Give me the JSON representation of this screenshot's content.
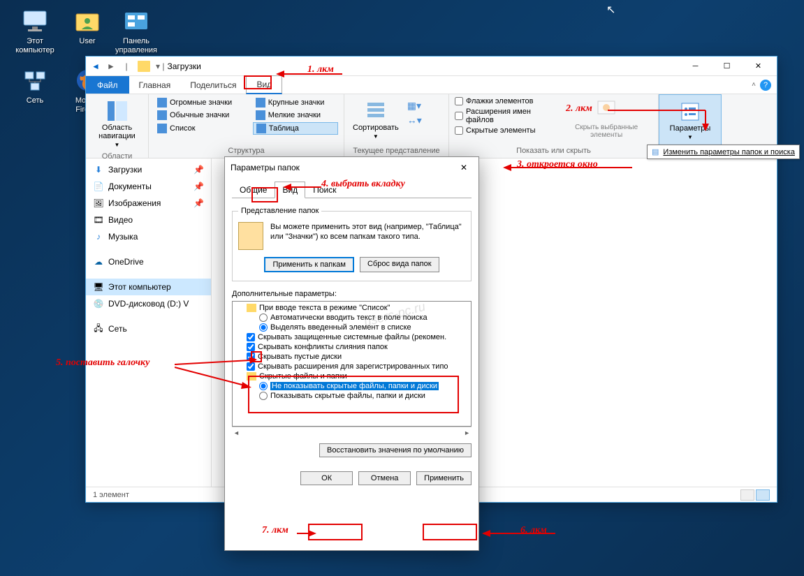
{
  "desktop": {
    "icons": [
      {
        "label": "Этот компьютер"
      },
      {
        "label": "User"
      },
      {
        "label": "Панель управления"
      },
      {
        "label": "Сеть"
      },
      {
        "label": "Mozilla Firefox"
      }
    ]
  },
  "explorer": {
    "title": "Загрузки",
    "menu_file": "Файл",
    "tabs": [
      "Главная",
      "Поделиться",
      "Вид"
    ],
    "ribbon": {
      "nav_panel": "Область навигации",
      "group_areas": "Области",
      "layouts": {
        "huge": "Огромные значки",
        "large": "Крупные значки",
        "normal": "Обычные значки",
        "small": "Мелкие значки",
        "list": "Список",
        "table": "Таблица"
      },
      "group_structure": "Структура",
      "sort": "Сортировать",
      "group_view": "Текущее представление",
      "chk_flags": "Флажки элементов",
      "chk_ext": "Расширения имен файлов",
      "chk_hidden": "Скрытые элементы",
      "hide_selected": "Скрыть выбранные элементы",
      "params": "Параметры",
      "group_show": "Показать или скрыть"
    },
    "tooltip": "Изменить параметры папок и поиска",
    "nav": {
      "downloads": "Загрузки",
      "documents": "Документы",
      "pictures": "Изображения",
      "videos": "Видео",
      "music": "Музыка",
      "onedrive": "OneDrive",
      "this_pc": "Этот компьютер",
      "dvd": "DVD-дисковод (D:) V",
      "network": "Сеть"
    },
    "status": "1 элемент"
  },
  "dialog": {
    "title": "Параметры папок",
    "tabs": {
      "general": "Общие",
      "view": "Вид",
      "search": "Поиск"
    },
    "fieldset_label": "Представление папок",
    "fieldset_text": "Вы можете применить этот вид (например, \"Таблица\" или \"Значки\") ко всем папкам такого типа.",
    "apply_folders": "Применить к папкам",
    "reset_folders": "Сброс вида папок",
    "adv_label": "Дополнительные параметры:",
    "tree": {
      "input_mode": "При вводе текста в режиме \"Список\"",
      "auto_type": "Автоматически вводить текст в поле поиска",
      "highlight": "Выделять введенный элемент в списке",
      "hide_sys": "Скрывать защищенные системные файлы (рекомен.",
      "hide_merge": "Скрывать конфликты слияния папок",
      "hide_empty": "Скрывать пустые диски",
      "hide_ext": "Скрывать расширения для зарегистрированных типо",
      "hidden_folder": "Скрытые файлы и папки",
      "dont_show": "Не показывать скрытые файлы, папки и диски",
      "show": "Показывать скрытые файлы, папки и диски"
    },
    "restore": "Восстановить значения по умолчанию",
    "ok": "ОК",
    "cancel": "Отмена",
    "apply": "Применить"
  },
  "annotations": {
    "a1": "1. лкм",
    "a2": "2. лкм",
    "a3": "3. откроется окно",
    "a4": "4. выбрать вкладку",
    "a5": "5. поставить галочку",
    "a6": "6. лкм",
    "a7": "7. лкм"
  },
  "watermark": "users-pc.ru"
}
